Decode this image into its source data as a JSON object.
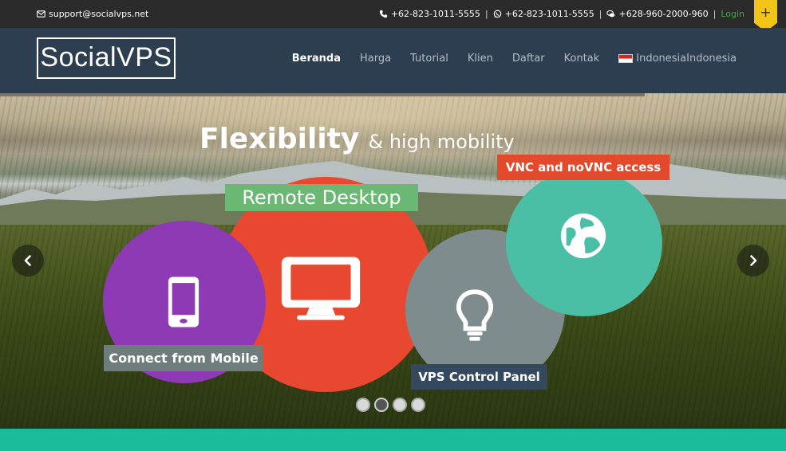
{
  "topbar": {
    "email": "support@socialvps.net",
    "phone1": "+62-823-1011-5555",
    "phone2": "+62-823-1011-5555",
    "chat": "+628-960-2000-960",
    "login": "Login",
    "plus": "+",
    "icons": {
      "email": "envelope-icon",
      "phone": "phone-icon",
      "whatsapp": "whatsapp-icon",
      "chat": "chat-icon"
    },
    "colors": {
      "background": "#2b2b2b",
      "login": "#3fa845",
      "ribbon": "#f3c418"
    }
  },
  "navbar": {
    "logo": "SocialVPS",
    "items": [
      {
        "label": "Beranda",
        "active": true
      },
      {
        "label": "Harga",
        "active": false
      },
      {
        "label": "Tutorial",
        "active": false
      },
      {
        "label": "Klien",
        "active": false
      },
      {
        "label": "Daftar",
        "active": false
      },
      {
        "label": "Kontak",
        "active": false
      }
    ],
    "language": "IndonesiaIndonesia",
    "colors": {
      "background": "#2c3e50",
      "active": "#ffffff",
      "inactive": "#b4bec9"
    }
  },
  "hero": {
    "title": "Flexibility",
    "subtitle": "& high mobility",
    "features": {
      "remote_desktop": "Remote Desktop",
      "vnc": "VNC and noVNC access",
      "mobile": "Connect from Mobile",
      "control_panel": "VPS Control Panel"
    },
    "icons": {
      "remote_desktop": "monitor-icon",
      "vnc": "globe-icon",
      "mobile": "mobile-phone-icon",
      "control_panel": "lightbulb-icon"
    },
    "colors": {
      "red": "#e8482f",
      "purple": "#8e3ab5",
      "gray": "#7f8c8d",
      "teal": "#4bbfa5",
      "green_label": "#6bb774"
    },
    "slides": 4,
    "active_slide": 2
  },
  "footer_band": {
    "color": "#1bbc9b"
  }
}
